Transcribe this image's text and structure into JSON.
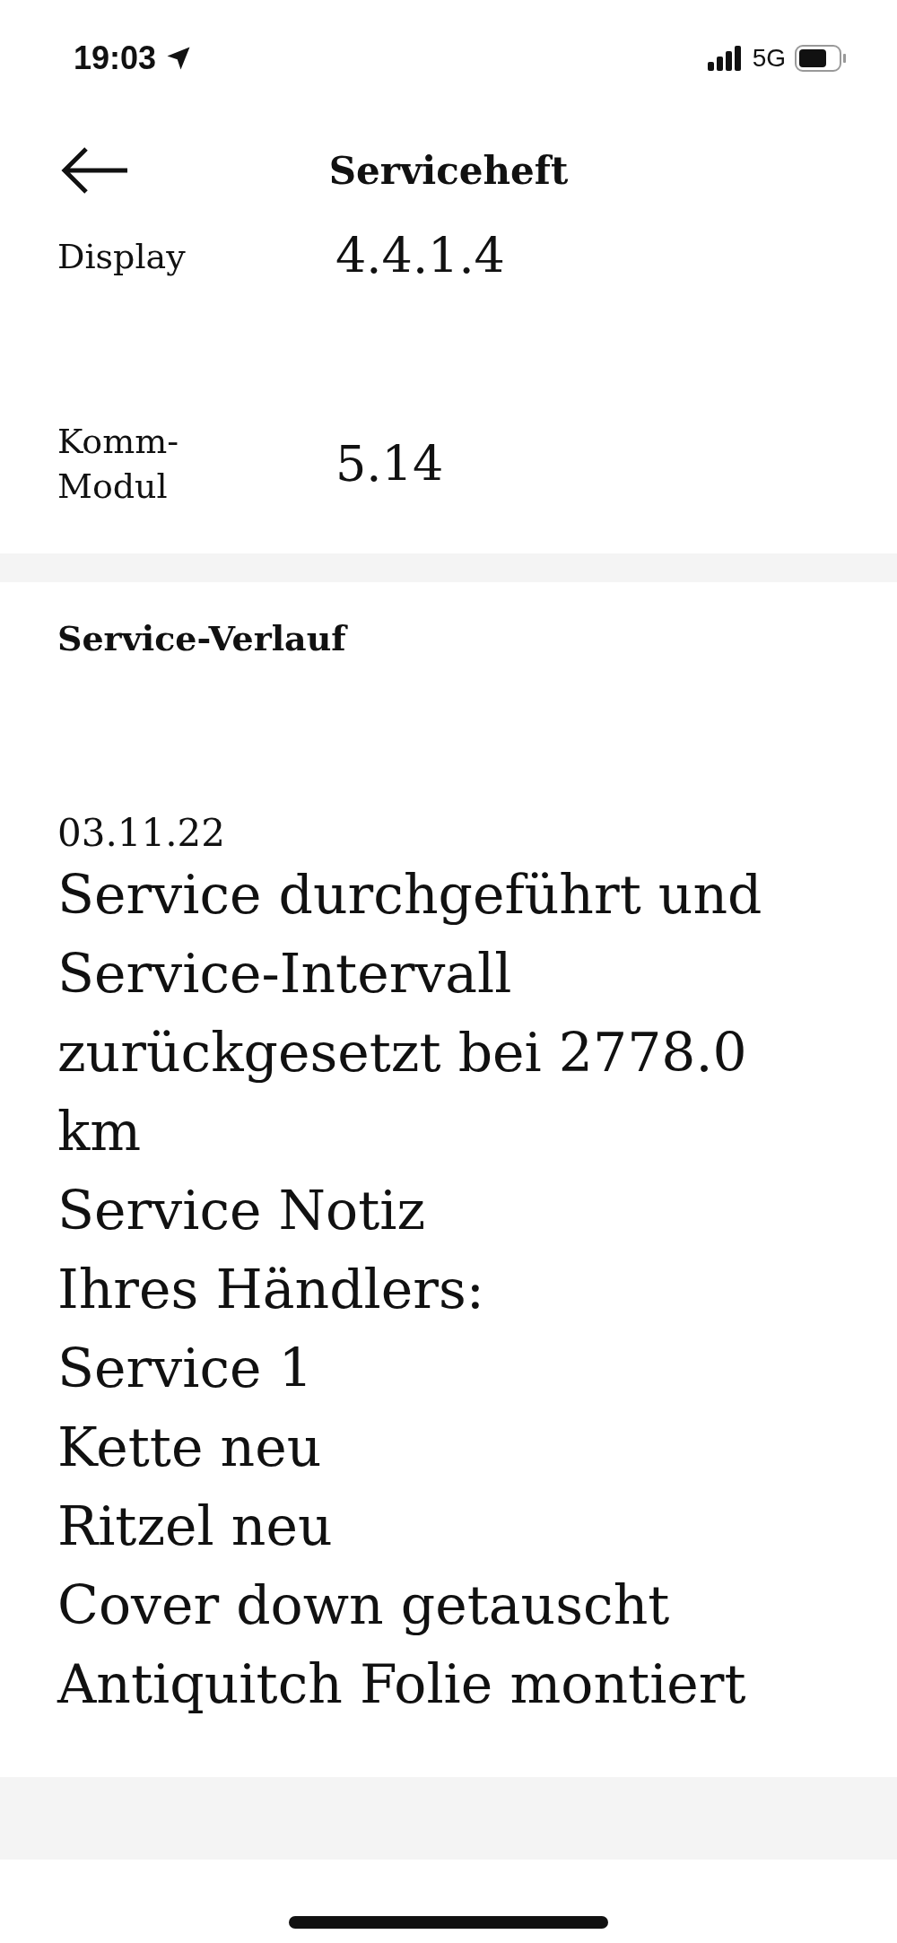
{
  "status_bar": {
    "time": "19:03",
    "network": "5G"
  },
  "header": {
    "title": "Serviceheft"
  },
  "versions": [
    {
      "label": "Display",
      "value": "4.4.1.4"
    },
    {
      "label": "Komm-Modul",
      "value": "5.14"
    }
  ],
  "service_history": {
    "title": "Service-Verlauf",
    "entries": [
      {
        "date": "03.11.22",
        "lines": [
          "Service durchgeführt und",
          "Service-Intervall",
          "zurückgesetzt bei 2778.0",
          "km",
          "Service Notiz",
          "Ihres Händlers:",
          "Service 1",
          "Kette neu",
          "Ritzel neu",
          "Cover down getauscht",
          "Antiquitch Folie montiert"
        ]
      }
    ]
  }
}
